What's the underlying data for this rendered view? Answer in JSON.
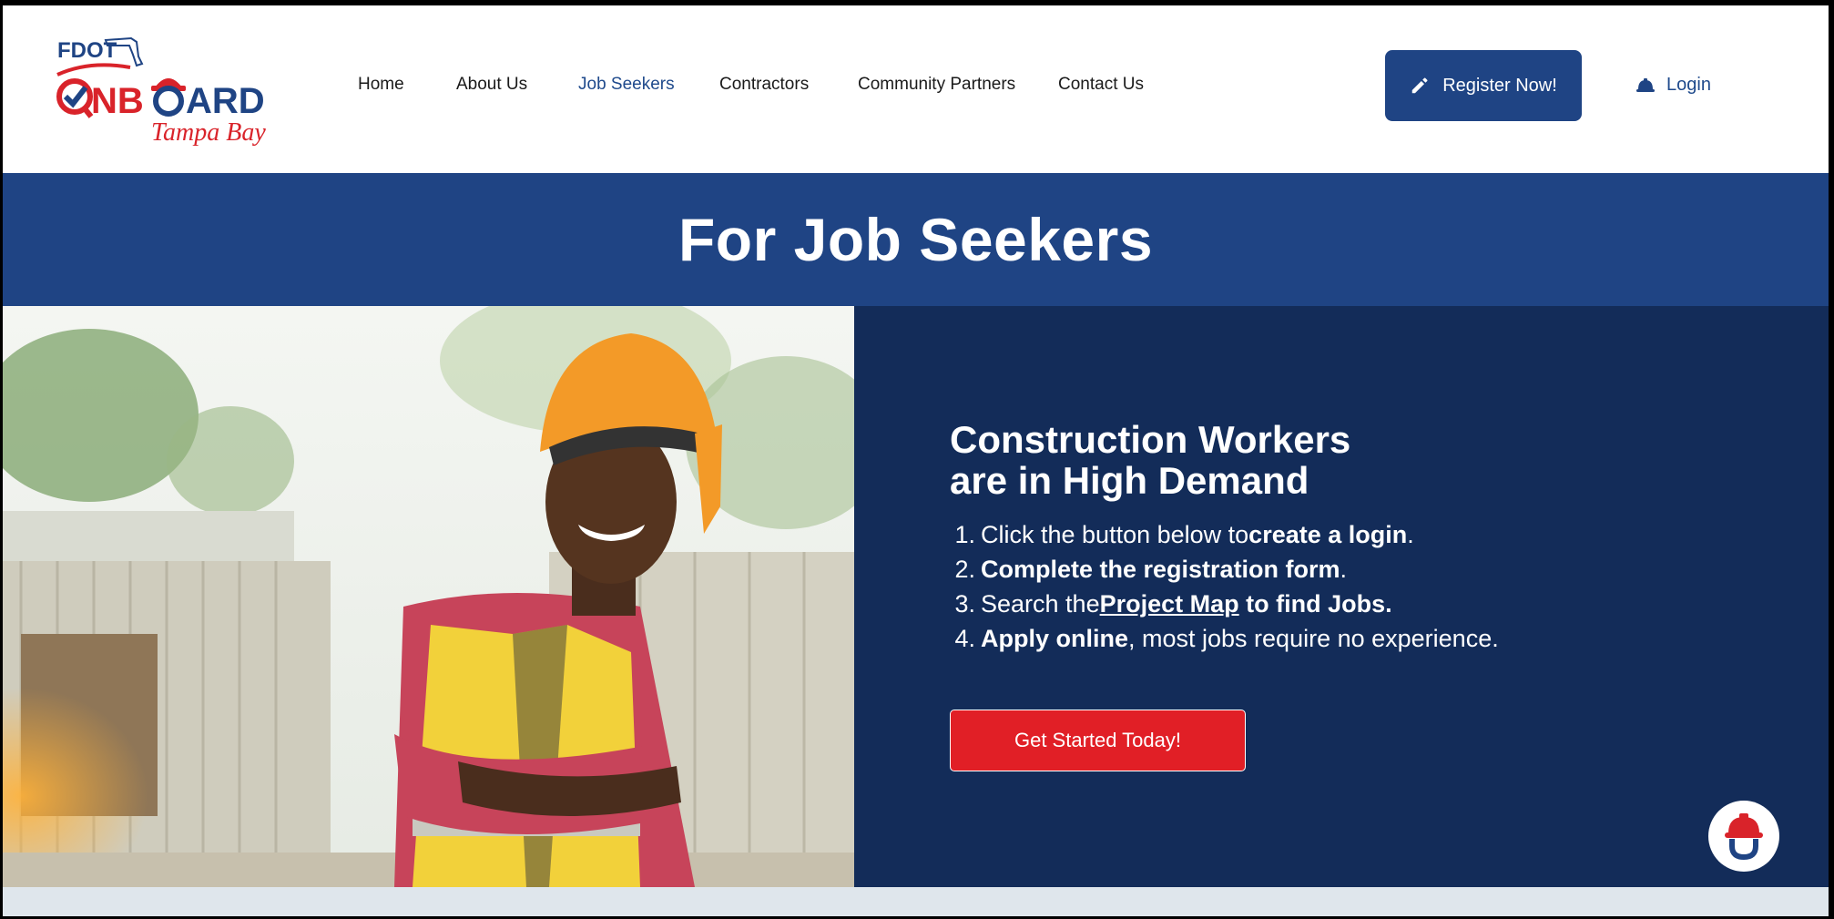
{
  "logo": {
    "brand_top": "FDOT",
    "brand_main_prefix": "NB",
    "brand_main_suffix": "ARD",
    "brand_sub": "Tampa Bay"
  },
  "nav": {
    "items": [
      {
        "label": "Home"
      },
      {
        "label": "About Us"
      },
      {
        "label": "Job Seekers"
      },
      {
        "label": "Contractors"
      },
      {
        "label": "Community Partners"
      },
      {
        "label": "Contact Us"
      }
    ],
    "active": "Job Seekers"
  },
  "header_actions": {
    "register_label": "Register Now!",
    "register_icon": "pencil-icon",
    "login_label": "Login",
    "login_icon": "hardhat-icon"
  },
  "page_title": "For Job Seekers",
  "hero": {
    "heading_line1": "Construction Workers",
    "heading_line2": "are in High Demand",
    "steps": [
      {
        "num": "1.",
        "pre": "Click the button below to ",
        "bold": "create a login",
        "post": "."
      },
      {
        "num": "2.",
        "pre": "",
        "bold": "Complete the registration form",
        "post": "."
      },
      {
        "num": "3.",
        "pre": "Search the ",
        "link": "Project Map",
        "bold": " to find Jobs.",
        "post": ""
      },
      {
        "num": "4.",
        "pre": "",
        "bold": "Apply online",
        "post": ", most jobs require no experience."
      }
    ],
    "cta_label": "Get Started Today!"
  },
  "colors": {
    "brand_blue": "#1f4484",
    "panel_navy": "#132c59",
    "cta_red": "#e11f26"
  }
}
